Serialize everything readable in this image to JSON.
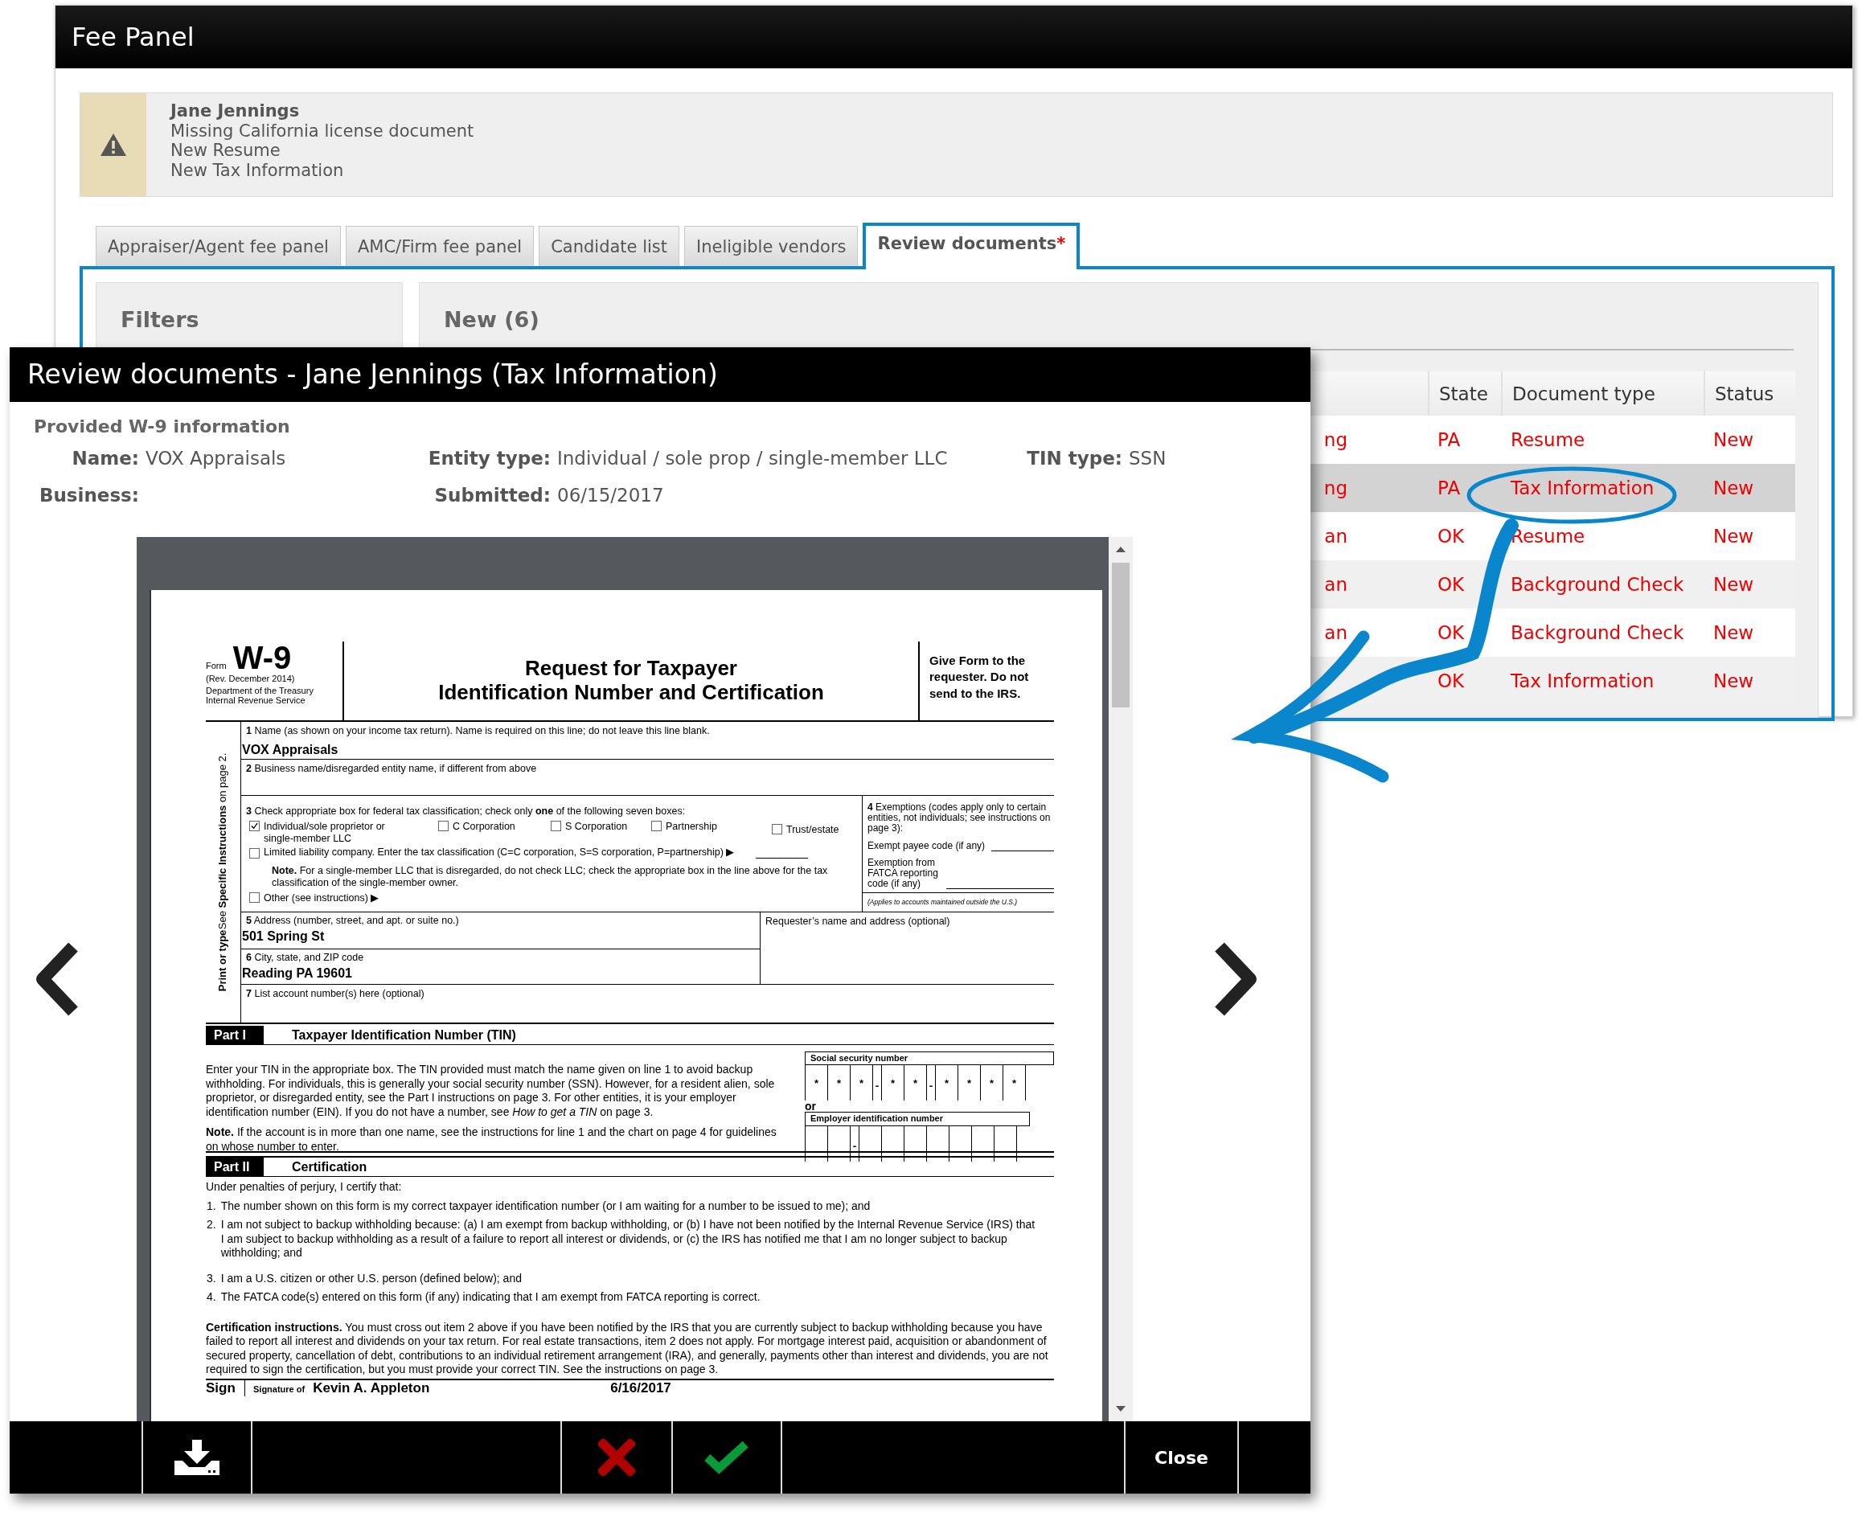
{
  "background_window": {
    "title": "Fee Panel",
    "alert": {
      "name": "Jane Jennings",
      "lines": [
        "Missing California license document",
        "New Resume",
        "New Tax Information"
      ]
    },
    "tabs": [
      {
        "label": "Appraiser/Agent fee panel",
        "selected": false
      },
      {
        "label": "AMC/Firm fee panel",
        "selected": false
      },
      {
        "label": "Candidate list",
        "selected": false
      },
      {
        "label": "Ineligible vendors",
        "selected": false
      },
      {
        "label": "Review documents",
        "selected": true,
        "marker": "*"
      }
    ],
    "filters": {
      "title": "Filters"
    },
    "documents": {
      "title": "New (6)",
      "columns": [
        "State",
        "Document type",
        "Status"
      ],
      "rows": [
        {
          "column_1": "ng",
          "state": "PA",
          "document_type": "Resume",
          "status": "New",
          "selected": false
        },
        {
          "column_1": "ng",
          "state": "PA",
          "document_type": "Tax Information",
          "status": "New",
          "selected": true
        },
        {
          "column_1": "an",
          "state": "OK",
          "document_type": "Resume",
          "status": "New",
          "selected": false
        },
        {
          "column_1": "an",
          "state": "OK",
          "document_type": "Background Check",
          "status": "New",
          "selected": false
        },
        {
          "column_1": "an",
          "state": "OK",
          "document_type": "Background Check",
          "status": "New",
          "selected": false
        },
        {
          "state": "OK",
          "document_type": "Tax Information",
          "status": "New",
          "selected": false
        }
      ]
    }
  },
  "modal": {
    "title": "Review documents - Jane Jennings (Tax Information)",
    "section_title": "Provided W-9 information",
    "fields": [
      {
        "label": "Name:",
        "value": "VOX Appraisals"
      },
      {
        "label": "Entity type:",
        "value": "Individual / sole prop / single-member LLC"
      },
      {
        "label": "TIN type:",
        "value": "SSN"
      },
      {
        "label": "Business:"
      },
      {
        "label": "Submitted:",
        "value": "06/15/2017"
      }
    ],
    "document": {
      "form_label": "Form",
      "form_number": "W-9",
      "revision": "(Rev. December 2014)",
      "agency": "Department of the Treasury Internal Revenue Service",
      "title_lines": [
        "Request for Taxpayer",
        "Identification Number and Certification"
      ],
      "instruction": "Give Form to the requester. Do not send to the IRS.",
      "side_labels": [
        "Print or type",
        "See **Specific Instructions** on page 2."
      ],
      "line1": {
        "label": "**1** Name (as shown on your income tax return). Name is required on this line; do not leave this line blank.",
        "value": "VOX Appraisals"
      },
      "line2": {
        "label": "**2** Business name/disregarded entity name, if different from above"
      },
      "line3": {
        "label": "**3** Check appropriate box for federal tax classification; check only **one** of the following seven boxes:",
        "options": [
          {
            "label": "Individual/sole proprietor or single-member LLC",
            "checked": true
          },
          {
            "label": "C Corporation",
            "checked": false
          },
          {
            "label": "S Corporation",
            "checked": false
          },
          {
            "label": "Partnership",
            "checked": false
          },
          {
            "label": "Trust/estate",
            "checked": false
          }
        ],
        "llc": {
          "label": "Limited liability company. Enter the tax classification (C=C corporation, S=S corporation, P=partnership) ▶",
          "checked": false
        },
        "note": "**Note.** For a single-member LLC that is disregarded, do not check LLC; check the appropriate box in the line above for the tax classification of the single-member owner.",
        "other": {
          "label": "Other (see instructions) ▶",
          "checked": false
        }
      },
      "exemptions": {
        "heading": "**4** Exemptions (codes apply only to certain entities, not individuals; see instructions on page 3):",
        "payee": "Exempt payee code (if any)",
        "fatca": "Exemption from FATCA reporting code (if any)",
        "footnote": "(Applies to accounts maintained outside the U.S.)"
      },
      "line5": {
        "label": "**5** Address (number, street, and apt. or suite no.)",
        "value": "501 Spring St"
      },
      "requester": "Requester’s name and address (optional)",
      "line6": {
        "label": "**6** City, state, and ZIP code",
        "value": "Reading PA 19601"
      },
      "line7": {
        "label": "**7** List account number(s) here (optional)"
      },
      "part1": {
        "tag": "Part I",
        "title": "Taxpayer Identification Number (TIN)",
        "text": "Enter your TIN in the appropriate box. The TIN provided must match the name given on line 1 to avoid backup withholding. For individuals, this is generally your social security number (SSN). However, for a resident alien, sole proprietor, or disregarded entity, see the Part I instructions on page 3. For other entities, it is your employer identification number (EIN). If you do not have a number, see *How to get a TIN* on page 3.",
        "note": "**Note.** If the account is in more than one name, see the instructions for line 1 and the chart on page 4 for guidelines on whose number to enter.",
        "ssn": {
          "label": "Social security number",
          "groups": [
            [
              "*",
              "*",
              "*"
            ],
            [
              "*",
              "*"
            ],
            [
              "*",
              "*",
              "*",
              "*"
            ]
          ],
          "separator": "-"
        },
        "or": "or",
        "ein": {
          "label": "Employer identification number",
          "separator": "-"
        }
      },
      "part2": {
        "tag": "Part II",
        "title": "Certification",
        "intro": "Under penalties of perjury, I certify that:",
        "items": [
          {
            "number": "1.",
            "text": "The number shown on this form is my correct taxpayer identification number (or I am waiting for a number to be issued to me); and"
          },
          {
            "number": "2.",
            "text": "I am not subject to backup withholding because: (a) I am exempt from backup withholding, or (b) I have not been notified by the Internal Revenue Service (IRS) that I am subject to backup withholding as a result of a failure to report all interest or dividends, or (c) the IRS has notified me that I am no longer subject to backup withholding; and"
          },
          {
            "number": "3.",
            "text": "I am a U.S. citizen or other U.S. person (defined below); and"
          },
          {
            "number": "4.",
            "text": "The FATCA code(s) entered on this form (if any) indicating that I am exempt from FATCA reporting is correct."
          }
        ],
        "instructions": "**Certification instructions.** You must cross out item 2 above if you have been notified by the IRS that you are currently subject to backup withholding because you have failed to report all interest and dividends on your tax return. For real estate transactions, item 2 does not apply. For mortgage interest paid, acquisition or abandonment of secured property, cancellation of debt, contributions to an individual retirement arrangement (IRA), and generally, payments other than interest and dividends, you are not required to sign the certification, but you must provide your correct TIN. See the instructions on page 3."
      },
      "sign": {
        "label": "Sign",
        "signature_label": "Signature of",
        "signature": "Kevin A. Appleton",
        "date": "6/16/2017"
      }
    },
    "buttons": [
      {
        "kind": "download"
      },
      {
        "kind": "reject"
      },
      {
        "kind": "approve"
      },
      {
        "kind": "close",
        "label": "Close"
      }
    ]
  }
}
